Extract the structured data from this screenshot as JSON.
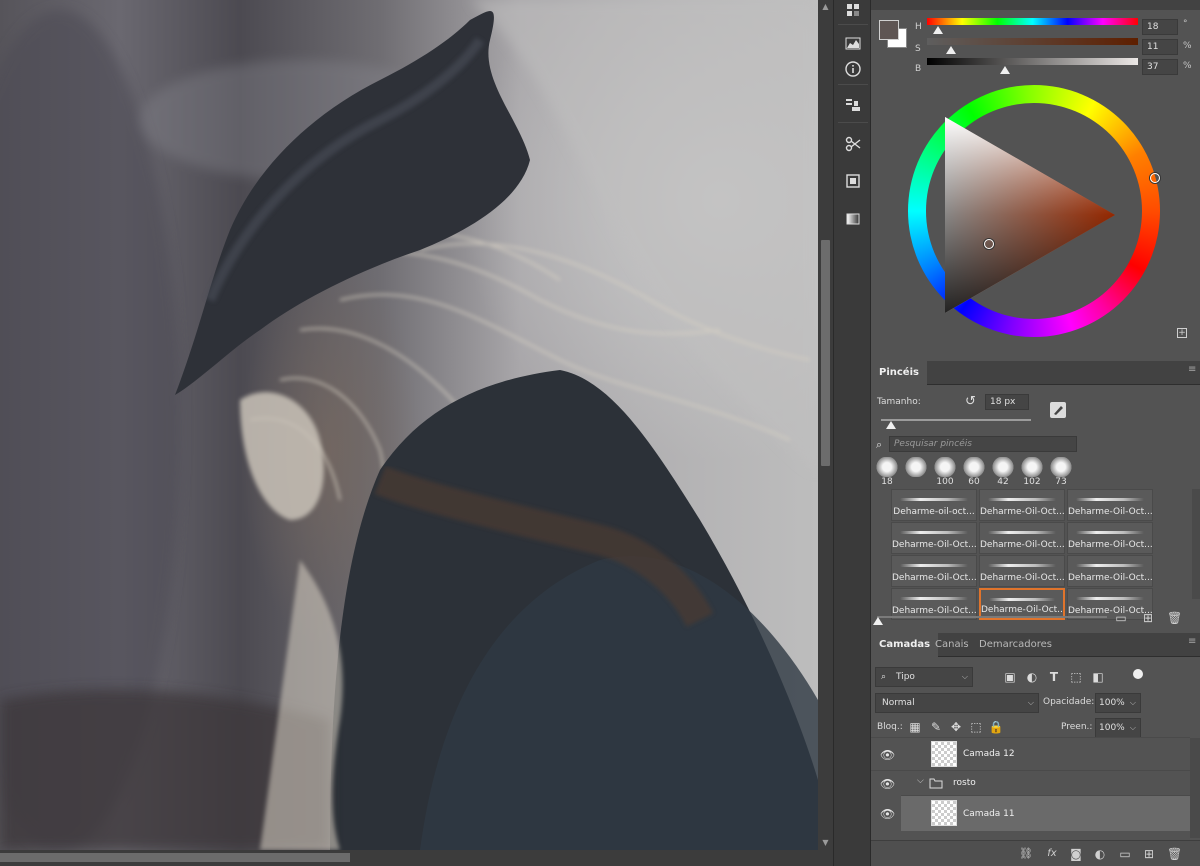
{
  "color": {
    "sliders": [
      {
        "label": "H",
        "value": "18",
        "unit": "°",
        "fraction": 0.05
      },
      {
        "label": "S",
        "value": "11",
        "unit": "%",
        "fraction": 0.11
      },
      {
        "label": "B",
        "value": "37",
        "unit": "%",
        "fraction": 0.37
      }
    ],
    "foreground": "#5e5553",
    "background": "#ffffff"
  },
  "brushes": {
    "tab": "Pincéis",
    "size_label": "Tamanho:",
    "size_value": "18 px",
    "search_placeholder": "Pesquisar pincéis",
    "recent": [
      "18",
      "",
      "100",
      "60",
      "42",
      "102",
      "73"
    ],
    "grid": [
      "Deharme-oil-oct...",
      "Deharme-Oil-Oct...",
      "Deharme-Oil-Oct...",
      "Deharme-Oil-Oct...",
      "Deharme-Oil-Oct...",
      "Deharme-Oil-Oct...",
      "Deharme-Oil-Oct...",
      "Deharme-Oil-Oct...",
      "Deharme-Oil-Oct...",
      "Deharme-Oil-Oct...",
      "Deharme-Oil-Oct...",
      "Deharme-Oil-Oct..."
    ],
    "selected_index": 10
  },
  "layers": {
    "tabs": [
      "Camadas",
      "Canais",
      "Demarcadores"
    ],
    "filter_label": "Tipo",
    "blend_mode": "Normal",
    "opacity_label": "Opacidade:",
    "opacity_value": "100%",
    "lock_label": "Bloq.:",
    "fill_label": "Preen.:",
    "fill_value": "100%",
    "items": [
      {
        "name": "Camada 12",
        "type": "layer",
        "selected": false
      },
      {
        "name": "rosto",
        "type": "group",
        "selected": false
      },
      {
        "name": "Camada 11",
        "type": "layer",
        "selected": true
      }
    ]
  },
  "accent": "#e0742c"
}
